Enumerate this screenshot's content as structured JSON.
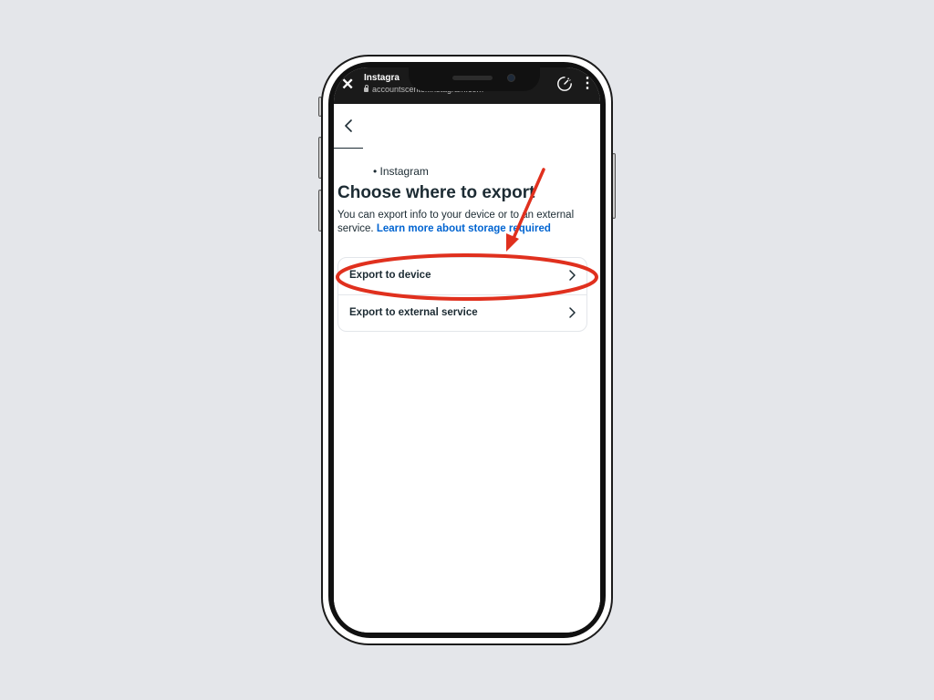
{
  "browser": {
    "title": "Instagra",
    "url": "accountscenter.instagram.com"
  },
  "page": {
    "account_line": "• Instagram",
    "title": "Choose where to export",
    "description": "You can export info to your device or to an external service.",
    "learn_more": "Learn more about storage required"
  },
  "options": [
    {
      "label": "Export to device"
    },
    {
      "label": "Export to external service"
    }
  ],
  "icons": {
    "close": "close-icon",
    "lock": "lock-icon",
    "speed": "speedometer-icon",
    "more": "more-vertical-icon",
    "back": "back-arrow-icon",
    "chevron": "chevron-right-icon"
  },
  "colors": {
    "background": "#e4e6ea",
    "link": "#0064d1",
    "text": "#1c2b33",
    "annotation": "#e0301e"
  }
}
